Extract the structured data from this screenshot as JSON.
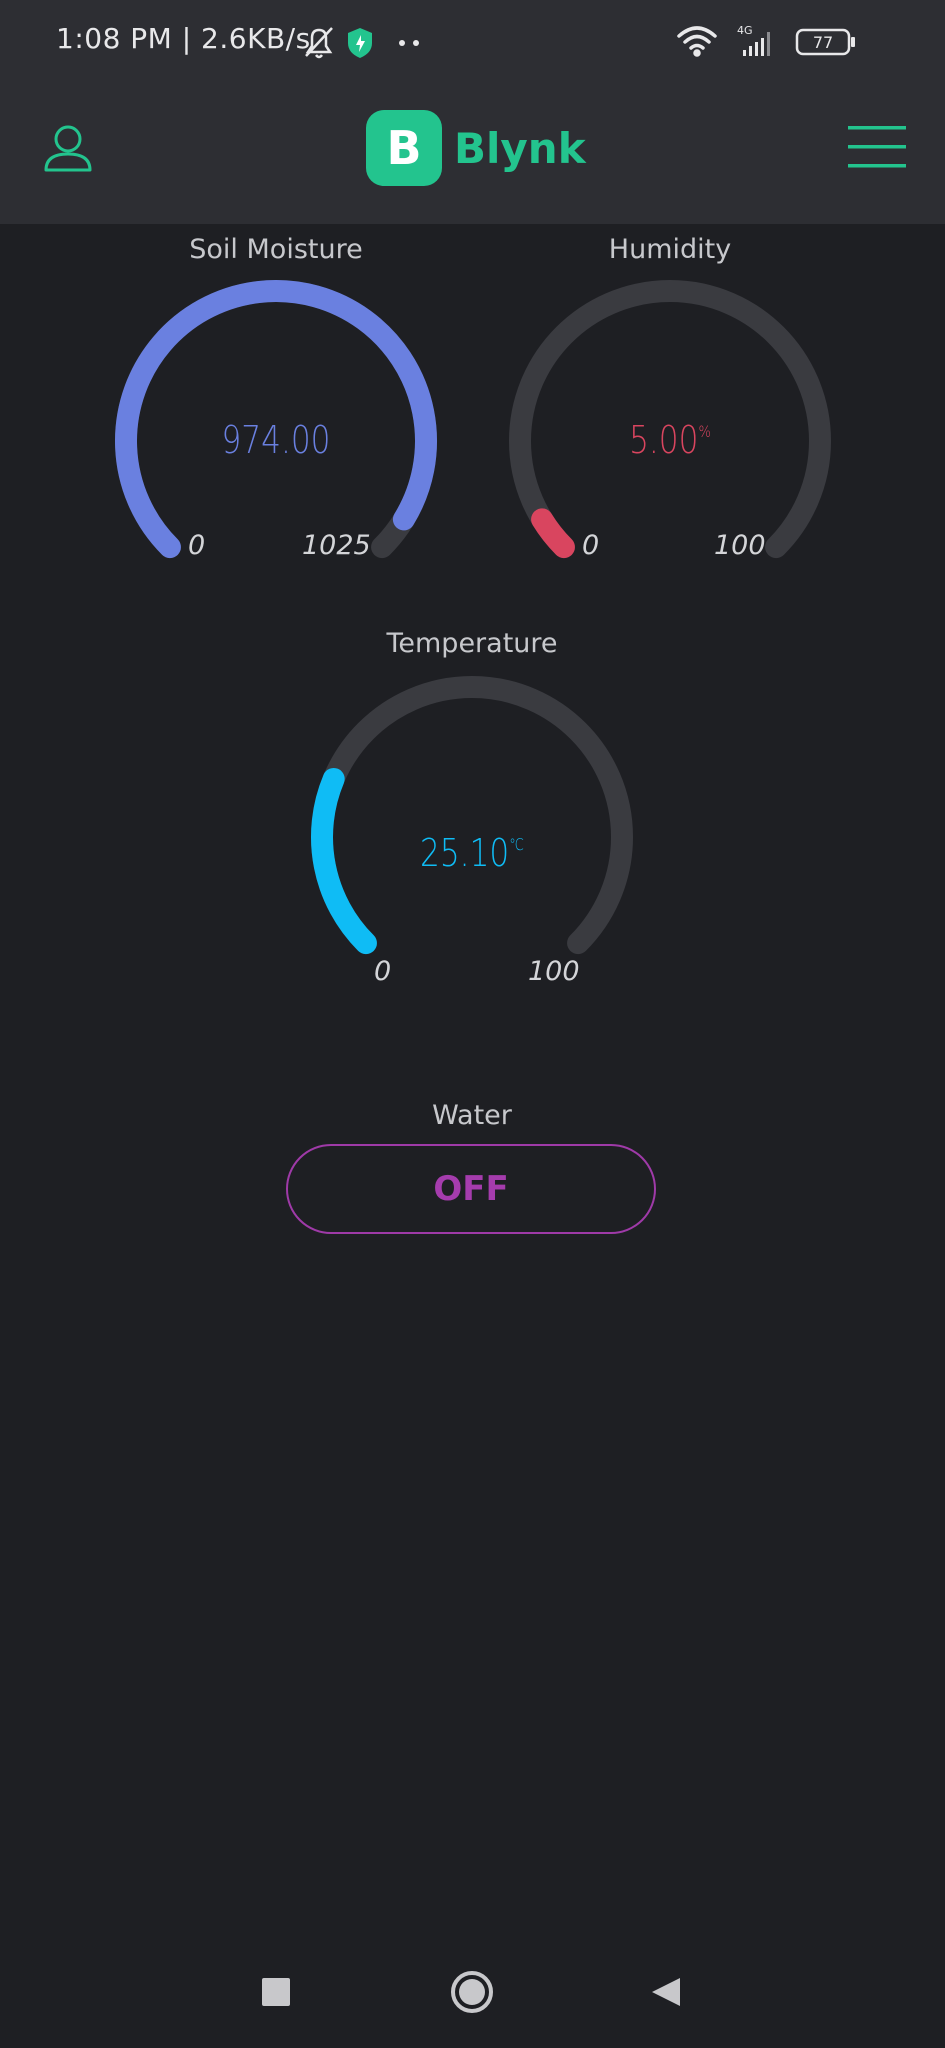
{
  "status_bar": {
    "time_speed": "1:08 PM | 2.6KB/s",
    "network": "4G",
    "battery": "77"
  },
  "app": {
    "logo_letter": "B",
    "name": "Blynk",
    "accent": "#23c48e"
  },
  "gauges": {
    "soil": {
      "title": "Soil Moisture",
      "value": "974.00",
      "unit": "",
      "min": "0",
      "max": "1025",
      "fraction": 0.95,
      "color": "#6a80e0"
    },
    "humidity": {
      "title": "Humidity",
      "value": "5.00",
      "unit": "%",
      "min": "0",
      "max": "100",
      "fraction": 0.05,
      "color": "#d9455f"
    },
    "temperature": {
      "title": "Temperature",
      "value": "25.10",
      "unit": "℃",
      "min": "0",
      "max": "100",
      "fraction": 0.251,
      "color": "#0fbcf5"
    }
  },
  "water": {
    "title": "Water",
    "state": "OFF",
    "color": "#a53cad"
  }
}
